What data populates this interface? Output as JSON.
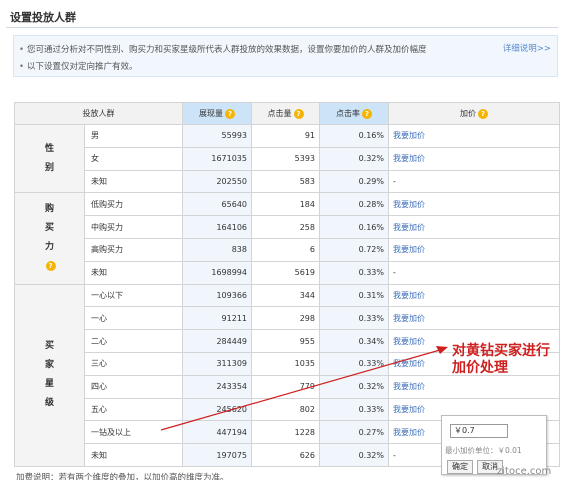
{
  "page_title": "设置投放人群",
  "info": {
    "lines": [
      "您可通过分析对不同性别、购买力和买家星级所代表人群投放的效果数据，设置你要加价的人群及加价幅度",
      "以下设置仅对定向推广有效。"
    ],
    "link": "详细说明>>"
  },
  "table": {
    "headers": {
      "group": "投放人群",
      "impressions": "展现量",
      "clicks": "点击量",
      "ctr": "点击率",
      "bid": "加价"
    },
    "groups": [
      {
        "label": [
          "性",
          "别"
        ],
        "rows": [
          {
            "name": "男",
            "impressions": "55993",
            "clicks": "91",
            "ctr": "0.16%",
            "bid": "我要加价"
          },
          {
            "name": "女",
            "impressions": "1671035",
            "clicks": "5393",
            "ctr": "0.32%",
            "bid": "我要加价"
          },
          {
            "name": "未知",
            "impressions": "202550",
            "clicks": "583",
            "ctr": "0.29%",
            "bid": "-"
          }
        ]
      },
      {
        "label": [
          "购",
          "买",
          "力"
        ],
        "rows": [
          {
            "name": "低购买力",
            "impressions": "65640",
            "clicks": "184",
            "ctr": "0.28%",
            "bid": "我要加价"
          },
          {
            "name": "中购买力",
            "impressions": "164106",
            "clicks": "258",
            "ctr": "0.16%",
            "bid": "我要加价"
          },
          {
            "name": "高购买力",
            "impressions": "838",
            "clicks": "6",
            "ctr": "0.72%",
            "bid": "我要加价"
          },
          {
            "name": "未知",
            "impressions": "1698994",
            "clicks": "5619",
            "ctr": "0.33%",
            "bid": "-"
          }
        ]
      },
      {
        "label": [
          "买",
          "家",
          "星",
          "级"
        ],
        "rows": [
          {
            "name": "一心以下",
            "impressions": "109366",
            "clicks": "344",
            "ctr": "0.31%",
            "bid": "我要加价"
          },
          {
            "name": "一心",
            "impressions": "91211",
            "clicks": "298",
            "ctr": "0.33%",
            "bid": "我要加价"
          },
          {
            "name": "二心",
            "impressions": "284449",
            "clicks": "955",
            "ctr": "0.34%",
            "bid": "我要加价"
          },
          {
            "name": "三心",
            "impressions": "311309",
            "clicks": "1035",
            "ctr": "0.33%",
            "bid": "我要加价"
          },
          {
            "name": "四心",
            "impressions": "243354",
            "clicks": "779",
            "ctr": "0.32%",
            "bid": "我要加价"
          },
          {
            "name": "五心",
            "impressions": "245620",
            "clicks": "802",
            "ctr": "0.33%",
            "bid": "我要加价"
          },
          {
            "name": "一钻及以上",
            "impressions": "447194",
            "clicks": "1228",
            "ctr": "0.27%",
            "bid": "我要加价"
          },
          {
            "name": "未知",
            "impressions": "197075",
            "clicks": "626",
            "ctr": "0.32%",
            "bid": "-"
          }
        ]
      }
    ]
  },
  "popup": {
    "input_value": "￥0.7",
    "min_unit": "最小加价单位：￥0.01",
    "confirm": "确定",
    "cancel": "取消"
  },
  "annotation": {
    "line1": "对黄钻买家进行",
    "line2": "加价处理",
    "color": "#cf1f1f"
  },
  "footnote": "加费说明：若有两个维度的叠加，以加价高的维度为准。",
  "watermark": "zitoce.com",
  "colors": {
    "link": "#3f6fba",
    "help_icon": "#f4b400",
    "highlight_column": "#f0f6fc"
  }
}
